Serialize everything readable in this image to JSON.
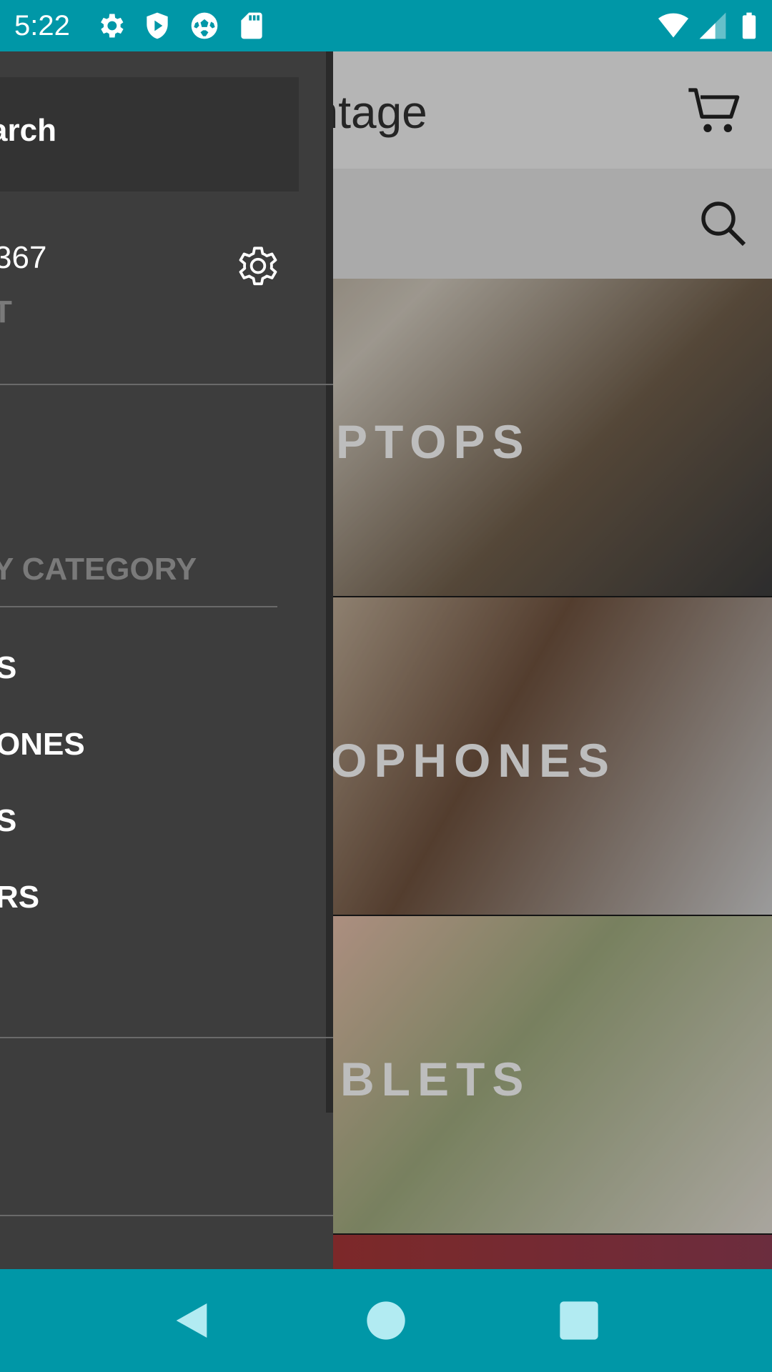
{
  "status_bar": {
    "time": "5:22",
    "color": "#0097a7",
    "icons": [
      "gear-icon",
      "shield-icon",
      "soccer-ball-icon",
      "sd-card-icon",
      "wifi-icon",
      "signal-icon",
      "battery-icon"
    ]
  },
  "app": {
    "title": "vantage",
    "cart_icon": "shopping-cart-icon",
    "search_icon": "search-icon",
    "categories": [
      {
        "label": "PTOPS"
      },
      {
        "label": "OPHONES"
      },
      {
        "label": "BLETS"
      }
    ]
  },
  "drawer": {
    "search_label": "arch",
    "user_id": "367",
    "user_sub": "T",
    "settings_icon": "gear-icon",
    "section_title": "Y CATEGORY",
    "items": [
      {
        "label": "S"
      },
      {
        "label": "ONES"
      },
      {
        "label": "S"
      },
      {
        "label": "RS"
      }
    ]
  },
  "nav_bar": {
    "buttons": [
      "back-icon",
      "home-icon",
      "recents-icon"
    ],
    "color": "#0097a7"
  }
}
